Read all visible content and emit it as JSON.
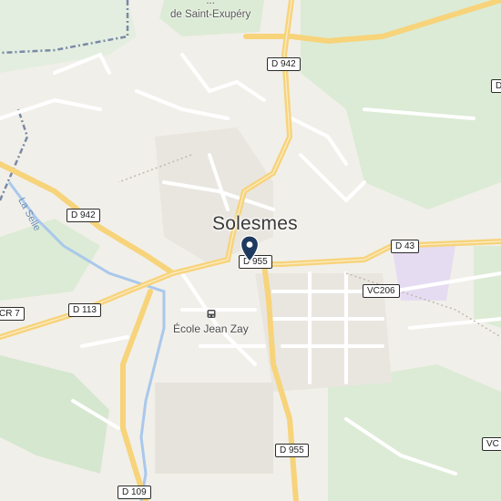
{
  "map": {
    "town": "Solesmes",
    "college": {
      "line1": "...",
      "line2": "de Saint-Exupéry"
    },
    "school": "École Jean Zay",
    "river": "La Selle",
    "road_shields": [
      "D 942",
      "D 942",
      "D 955",
      "D 43",
      "VC206",
      "D 113",
      "CR 7",
      "D 955",
      "D 109",
      "VC",
      "D"
    ],
    "icons": {
      "school": "bus-stop-icon",
      "pin": "location-pin-icon"
    },
    "colors": {
      "land": "#f1efe9",
      "park": "#dcebd5",
      "major_road": "#f7d37a",
      "water": "#a9c8ec",
      "pin": "#1f3a5f"
    }
  }
}
